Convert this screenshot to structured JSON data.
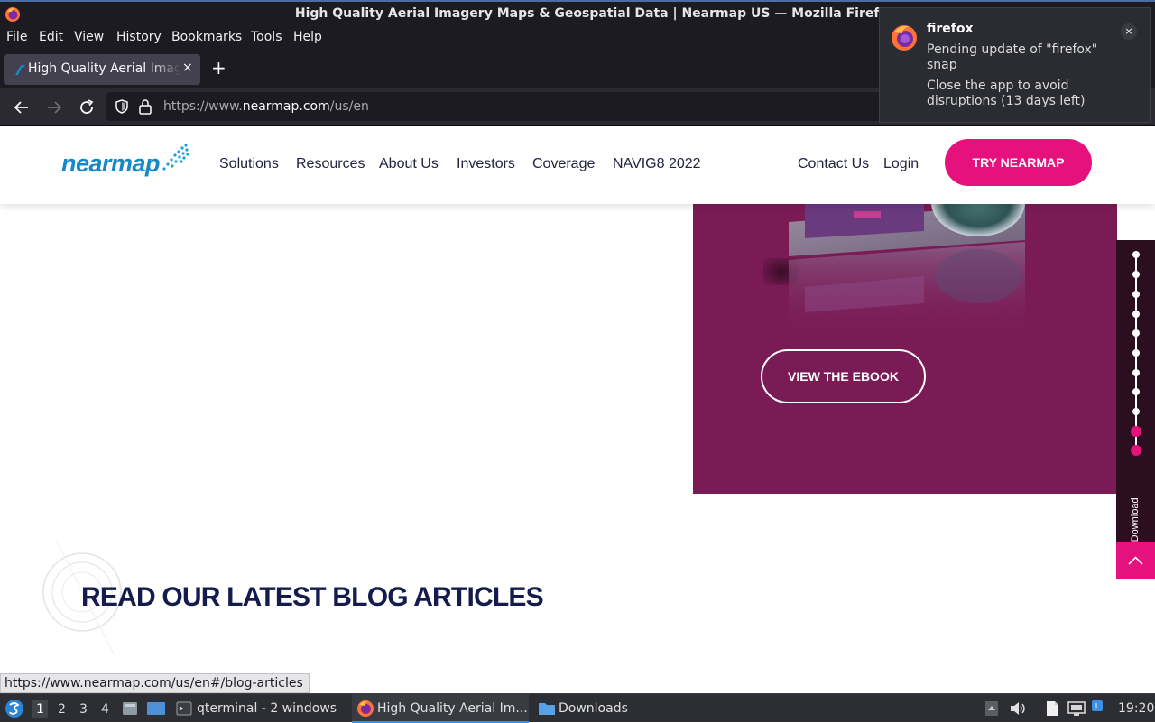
{
  "window": {
    "title": "High Quality Aerial Imagery Maps & Geospatial Data | Nearmap US — Mozilla Firefox"
  },
  "menu": [
    "File",
    "Edit",
    "View",
    "History",
    "Bookmarks",
    "Tools",
    "Help"
  ],
  "tab": {
    "title": "High Quality Aerial Imagery Maps & Geospatial Data | Nearmap US",
    "close": "×",
    "new_tab": "+"
  },
  "urlbar": {
    "prefix": "https://www.",
    "domain": "nearmap.com",
    "path": "/us/en"
  },
  "notification": {
    "app": "firefox",
    "message": "Pending update of \"firefox\" snap",
    "detail": "Close the app to avoid disruptions (13 days left)",
    "close": "×"
  },
  "site": {
    "logo": "nearmap",
    "nav": [
      "Solutions",
      "Resources",
      "About Us",
      "Investors",
      "Coverage",
      "NAVIG8 2022"
    ],
    "contact": "Contact Us",
    "login": "Login",
    "cta": "TRY NEARMAP",
    "accent_color": "#e5127d",
    "promo_color": "#7a1b56"
  },
  "promo": {
    "button": "VIEW THE EBOOK"
  },
  "side_rail": {
    "label": "Ebook Download",
    "visible_label": "ok Download"
  },
  "blog": {
    "heading": "READ OUR LATEST BLOG ARTICLES"
  },
  "status_url": "https://www.nearmap.com/us/en#/blog-articles",
  "taskbar": {
    "workspaces": [
      "1",
      "2",
      "3",
      "4"
    ],
    "tasks": [
      "qterminal - 2 windows",
      "High Quality Aerial Im...",
      "Downloads"
    ],
    "clock": "19:20"
  }
}
